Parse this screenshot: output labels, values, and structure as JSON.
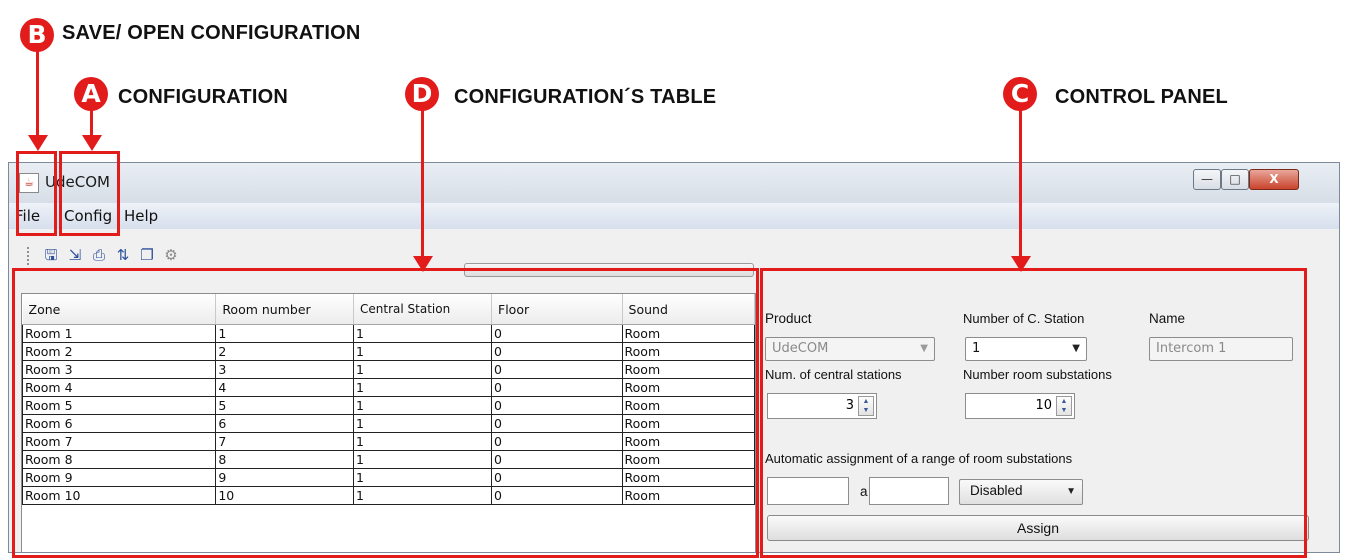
{
  "annotations": {
    "b": {
      "letter": "B",
      "label": "SAVE/ OPEN CONFIGURATION"
    },
    "a": {
      "letter": "A",
      "label": "CONFIGURATION"
    },
    "d": {
      "letter": "D",
      "label": "CONFIGURATION´S TABLE"
    },
    "c": {
      "letter": "C",
      "label": "CONTROL PANEL"
    },
    "color": "#e21b1b"
  },
  "window": {
    "title": "UdeCOM",
    "app_icon": "java-app-icon",
    "controls": {
      "minimize": "—",
      "maximize": "□",
      "close": "X"
    }
  },
  "menu": {
    "file": "File",
    "config": "Config",
    "help": "Help"
  },
  "toolbar": {
    "icons": [
      "save-icon",
      "open-icon",
      "print-icon",
      "transfer-icon",
      "window-icon",
      "gear-icon"
    ]
  },
  "table": {
    "columns": [
      "Zone",
      "Room number",
      "Central Station",
      "Floor",
      "Sound"
    ],
    "rows": [
      [
        "Room 1",
        "1",
        "1",
        "0",
        "Room"
      ],
      [
        "Room 2",
        "2",
        "1",
        "0",
        "Room"
      ],
      [
        "Room 3",
        "3",
        "1",
        "0",
        "Room"
      ],
      [
        "Room 4",
        "4",
        "1",
        "0",
        "Room"
      ],
      [
        "Room 5",
        "5",
        "1",
        "0",
        "Room"
      ],
      [
        "Room 6",
        "6",
        "1",
        "0",
        "Room"
      ],
      [
        "Room 7",
        "7",
        "1",
        "0",
        "Room"
      ],
      [
        "Room 8",
        "8",
        "1",
        "0",
        "Room"
      ],
      [
        "Room 9",
        "9",
        "1",
        "0",
        "Room"
      ],
      [
        "Room 10",
        "10",
        "1",
        "0",
        "Room"
      ]
    ]
  },
  "panel": {
    "product_label": "Product",
    "product_value": "UdeCOM",
    "num_cstation_label": "Number of C. Station",
    "num_cstation_value": "1",
    "name_label": "Name",
    "name_value": "Intercom 1",
    "num_central_label": "Num. of central stations",
    "num_central_value": "3",
    "num_room_label": "Number room substations",
    "num_room_value": "10",
    "auto_label": "Automatic assignment of a range of room substations",
    "range_from": "",
    "range_sep": "a",
    "range_to": "",
    "mode_value": "Disabled",
    "assign_label": "Assign"
  }
}
